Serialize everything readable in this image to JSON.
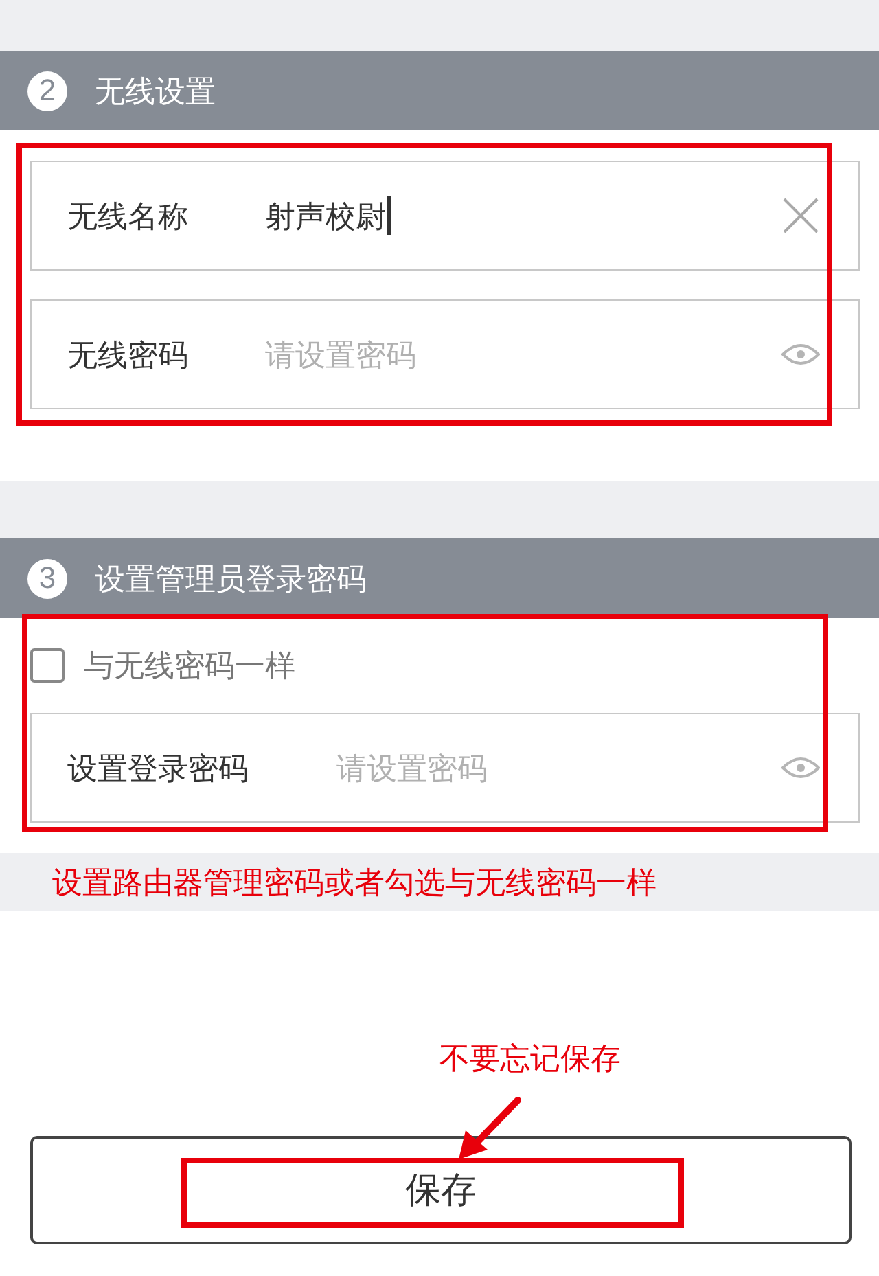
{
  "sections": [
    {
      "number": "2",
      "title": "无线设置",
      "fields": [
        {
          "kind": "text",
          "label": "无线名称",
          "value": "射声校尉",
          "focused": true
        },
        {
          "kind": "password",
          "label": "无线密码",
          "placeholder": "请设置密码"
        }
      ]
    },
    {
      "number": "3",
      "title": "设置管理员登录密码",
      "checkbox": {
        "label": "与无线密码一样",
        "checked": false
      },
      "fields": [
        {
          "kind": "password",
          "label": "设置登录密码",
          "placeholder": "请设置密码"
        }
      ],
      "note": "设置路由器管理密码或者勾选与无线密码一样"
    }
  ],
  "callout": "不要忘记保存",
  "save_button": {
    "label": "保存"
  }
}
